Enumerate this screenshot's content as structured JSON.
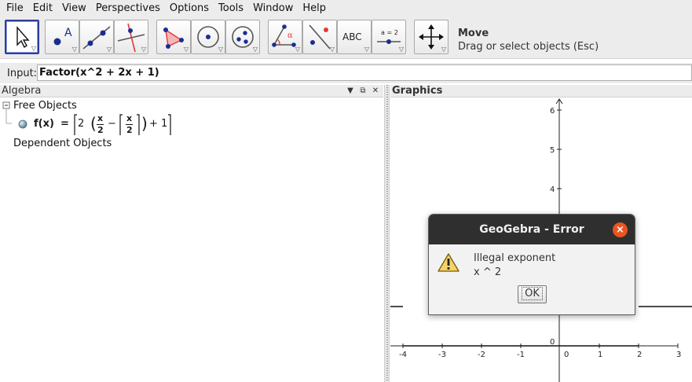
{
  "menu": [
    "File",
    "Edit",
    "View",
    "Perspectives",
    "Options",
    "Tools",
    "Window",
    "Help"
  ],
  "toolbar": {
    "tools": [
      {
        "name": "move-tool",
        "icon": "arrow-icon"
      },
      {
        "name": "point-tool",
        "icon": "point-icon"
      },
      {
        "name": "line-tool",
        "icon": "line-icon"
      },
      {
        "name": "perpendicular-tool",
        "icon": "perpendicular-line-icon"
      },
      {
        "name": "polygon-tool",
        "icon": "polygon-icon"
      },
      {
        "name": "circle-tool",
        "icon": "circle-center-point-icon"
      },
      {
        "name": "ellipse-tool",
        "icon": "circle-three-points-icon"
      },
      {
        "name": "angle-tool",
        "icon": "angle-icon"
      },
      {
        "name": "reflect-tool",
        "icon": "reflect-icon"
      },
      {
        "name": "text-tool",
        "icon": "text-icon",
        "label": "ABC"
      },
      {
        "name": "slider-tool",
        "icon": "slider-icon",
        "label": "a = 2"
      },
      {
        "name": "move-view-tool",
        "icon": "move-graphics-icon"
      }
    ],
    "help_title": "Move",
    "help_text": "Drag or select objects (Esc)"
  },
  "input": {
    "label": "Input:",
    "value": "Factor(x^2 + 2x + 1)"
  },
  "algebra": {
    "title": "Algebra",
    "free_objects": "Free Objects",
    "function": {
      "name": "f(x)",
      "equals": "=",
      "two": "2",
      "x": "x",
      "den": "2",
      "minus": "−",
      "plus_one": "+ 1"
    },
    "dependent_objects": "Dependent Objects"
  },
  "graphics": {
    "title": "Graphics",
    "x_ticks": [
      "-4",
      "-3",
      "-2",
      "-1",
      "0",
      "1",
      "2",
      "3"
    ],
    "y_ticks": [
      "6",
      "5",
      "4",
      "0"
    ]
  },
  "dialog": {
    "title": "GeoGebra - Error",
    "message": "Illegal exponent",
    "detail": "x ^ 2",
    "ok": "OK",
    "close": "×"
  },
  "colors": {
    "point": "#1a2e8f",
    "line": "#1a2e8f",
    "accent_red": "#e23a3a",
    "dialog_title_bg": "#2f2f2f",
    "close_button": "#e95420"
  }
}
